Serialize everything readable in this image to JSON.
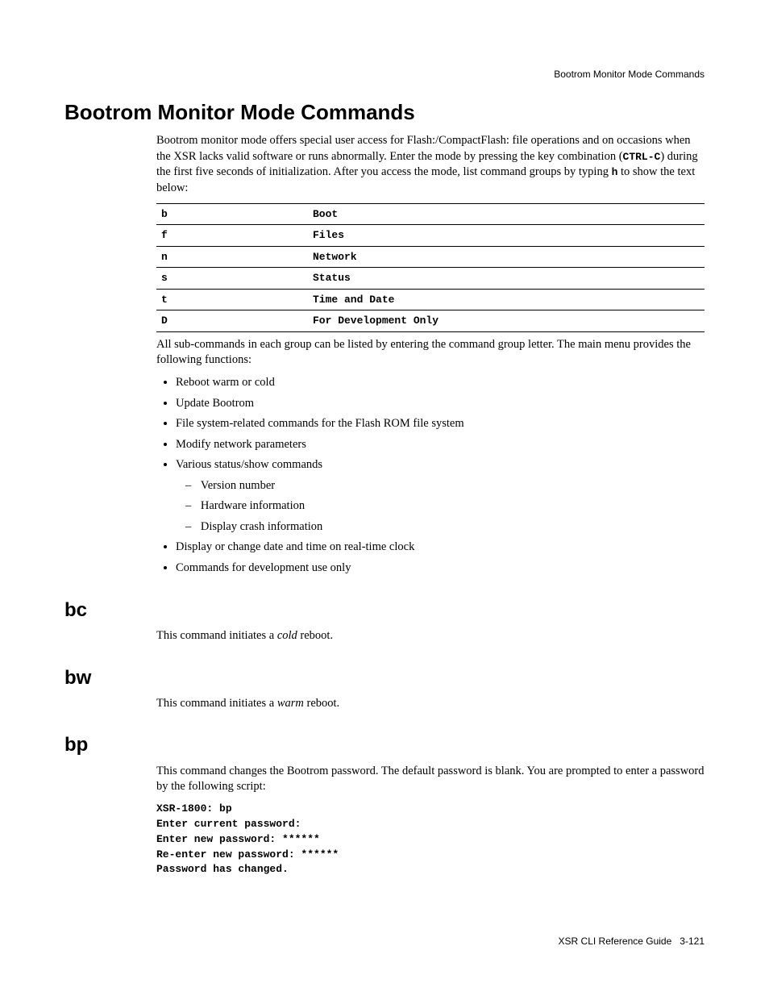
{
  "header": {
    "running": "Bootrom Monitor Mode Commands"
  },
  "title": "Bootrom Monitor Mode Commands",
  "intro": {
    "p1a": "Bootrom monitor mode offers special user access for Flash:/CompactFlash: file operations and on occasions when the XSR lacks valid software or runs abnormally. Enter the mode by pressing the key combination (",
    "ctrlc": "CTRL-C",
    "p1b": ") during the first five seconds of initialization. After you access the mode, list command groups by typing ",
    "hkey": "h",
    "p1c": " to show the text below:"
  },
  "table": {
    "rows": [
      {
        "key": "b",
        "desc": "Boot"
      },
      {
        "key": "f",
        "desc": "Files"
      },
      {
        "key": "n",
        "desc": "Network"
      },
      {
        "key": "s",
        "desc": "Status"
      },
      {
        "key": "t",
        "desc": "Time and Date"
      },
      {
        "key": "D",
        "desc": "For Development Only"
      }
    ]
  },
  "after_table": "All sub-commands in each group can be listed by entering the command group letter. The main menu provides the following functions:",
  "bullets": {
    "b0": "Reboot warm or cold",
    "b1": "Update Bootrom",
    "b2": "File system-related commands for the Flash ROM file system",
    "b3": "Modify network parameters",
    "b4": "Various status/show commands",
    "b4_sub": {
      "s0": "Version number",
      "s1": "Hardware information",
      "s2": "Display crash information"
    },
    "b5": "Display or change date and time on real-time clock",
    "b6": "Commands for development use only"
  },
  "bc": {
    "title": "bc",
    "before": "This command initiates a ",
    "em": "cold",
    "after": " reboot."
  },
  "bw": {
    "title": "bw",
    "before": "This command initiates a ",
    "em": "warm",
    "after": " reboot."
  },
  "bp": {
    "title": "bp",
    "p": "This command changes the Bootrom password. The default password is blank. You are prompted to enter a password by the following script:",
    "code": "XSR-1800: bp\nEnter current password:\nEnter new password: ******\nRe-enter new password: ******\nPassword has changed."
  },
  "footer": {
    "left": "XSR CLI Reference Guide",
    "right": "3-121"
  }
}
